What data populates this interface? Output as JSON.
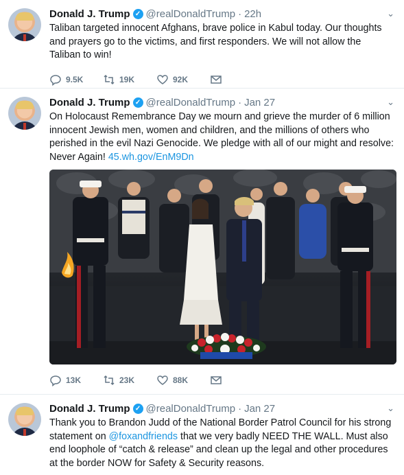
{
  "tweets": [
    {
      "name": "Donald J. Trump",
      "handle": "@realDonaldTrump",
      "time": "22h",
      "text": "Taliban targeted innocent Afghans, brave police in Kabul today. Our thoughts and prayers go to the victims, and first responders. We will not allow the Taliban to win!",
      "replies": "9.5K",
      "retweets": "19K",
      "likes": "92K"
    },
    {
      "name": "Donald J. Trump",
      "handle": "@realDonaldTrump",
      "time": "Jan 27",
      "text": "On Holocaust Remembrance Day we mourn and grieve the murder of 6 million innocent Jewish men, women and children, and the millions of others who perished in the evil Nazi Genocide. We pledge with all of our might and resolve: Never Again!",
      "link": "45.wh.gov/EnM9Dn",
      "replies": "13K",
      "retweets": "23K",
      "likes": "88K"
    },
    {
      "name": "Donald J. Trump",
      "handle": "@realDonaldTrump",
      "time": "Jan 27",
      "text_before": "Thank you to Brandon Judd of the National Border Patrol Council for his strong statement on",
      "mention": "@foxandfriends",
      "text_after": "that we very badly NEED THE WALL. Must also end loophole of “catch & release” and clean up the legal and other procedures at the border NOW for Safety & Security reasons."
    }
  ],
  "colors": {
    "accent": "#1da1f2",
    "link": "#1b95e0",
    "secondary_text": "#657786"
  }
}
